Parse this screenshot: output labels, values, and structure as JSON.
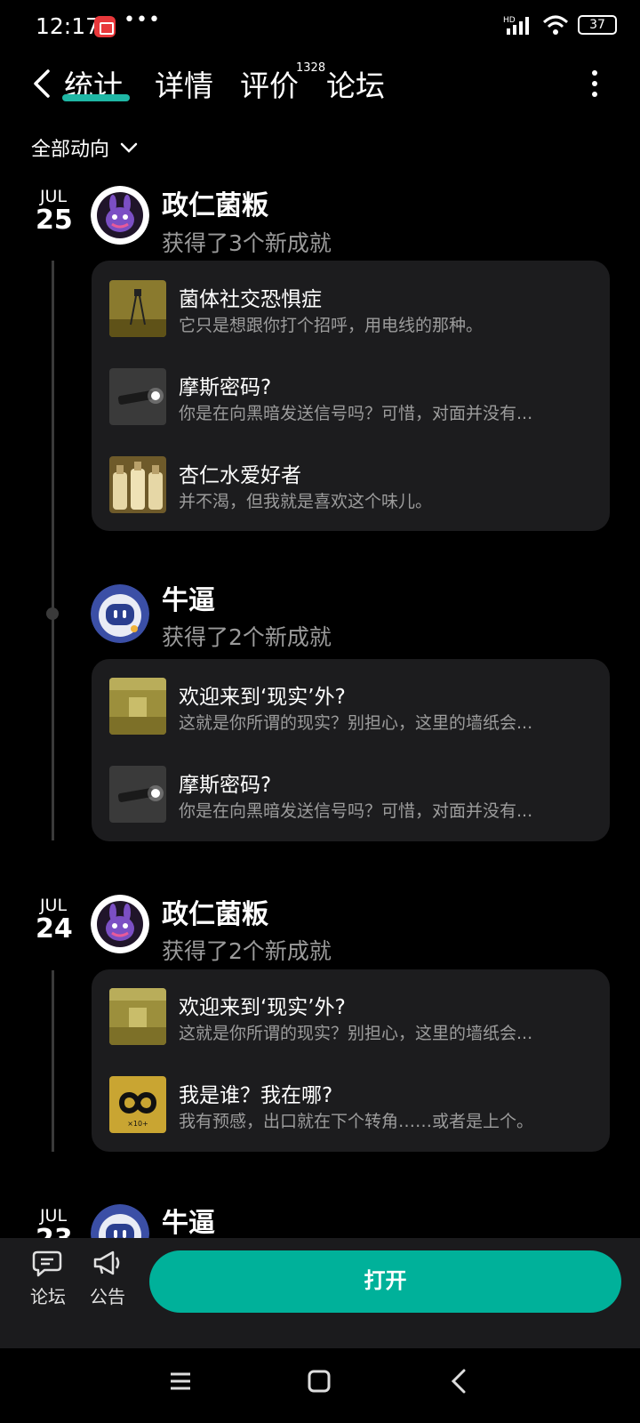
{
  "status_bar": {
    "time": "12:17",
    "more": "•••",
    "signal_label": "HD",
    "battery": "37"
  },
  "header": {
    "tabs": [
      {
        "label": "统计",
        "active": true
      },
      {
        "label": "详情"
      },
      {
        "label": "评价",
        "badge": "1328"
      },
      {
        "label": "论坛"
      }
    ],
    "accent_color": "#1fb7a5"
  },
  "filter": {
    "label": "全部动向"
  },
  "feed": [
    {
      "date": {
        "month": "JUL",
        "day": "25"
      },
      "user": {
        "name": "政仁菌粄",
        "summary": "获得了3个新成就",
        "avatar_icon": "purple-bunny-avatar"
      },
      "achievements": [
        {
          "title": "菌体社交恐惧症",
          "desc": "它只是想跟你打个招呼，用电线的那种。",
          "thumb": "yellow-room-figure-thumb"
        },
        {
          "title": "摩斯密码?",
          "desc": "你是在向黑暗发送信号吗？可惜，对面并没有...",
          "thumb": "flashlight-thumb"
        },
        {
          "title": "杏仁水爱好者",
          "desc": "并不渴，但我就是喜欢这个味儿。",
          "thumb": "bottles-thumb"
        }
      ]
    },
    {
      "user": {
        "name": "牛逼",
        "summary": "获得了2个新成就",
        "avatar_icon": "robot-avatar"
      },
      "achievements": [
        {
          "title": "欢迎来到‘现实’外?",
          "desc": "这就是你所谓的现实？别担心，这里的墙纸会...",
          "thumb": "yellow-hallway-thumb"
        },
        {
          "title": "摩斯密码?",
          "desc": "你是在向黑暗发送信号吗？可惜，对面并没有...",
          "thumb": "flashlight-thumb"
        }
      ]
    },
    {
      "date": {
        "month": "JUL",
        "day": "24"
      },
      "user": {
        "name": "政仁菌粄",
        "summary": "获得了2个新成就",
        "avatar_icon": "purple-bunny-avatar"
      },
      "achievements": [
        {
          "title": "欢迎来到‘现实’外?",
          "desc": "这就是你所谓的现实？别担心，这里的墙纸会...",
          "thumb": "yellow-hallway-thumb"
        },
        {
          "title": "我是谁？我在哪?",
          "desc": "我有预感，出口就在下个转角……或者是上个。",
          "thumb": "infinity-thumb",
          "thumb_text": "×10+"
        }
      ]
    },
    {
      "date": {
        "month": "JUL",
        "day": "23"
      },
      "user": {
        "name": "牛逼",
        "avatar_icon": "robot-avatar"
      }
    }
  ],
  "bottom_bar": {
    "forum_label": "论坛",
    "notice_label": "公告",
    "open_label": "打开",
    "open_color": "#00b19a"
  }
}
